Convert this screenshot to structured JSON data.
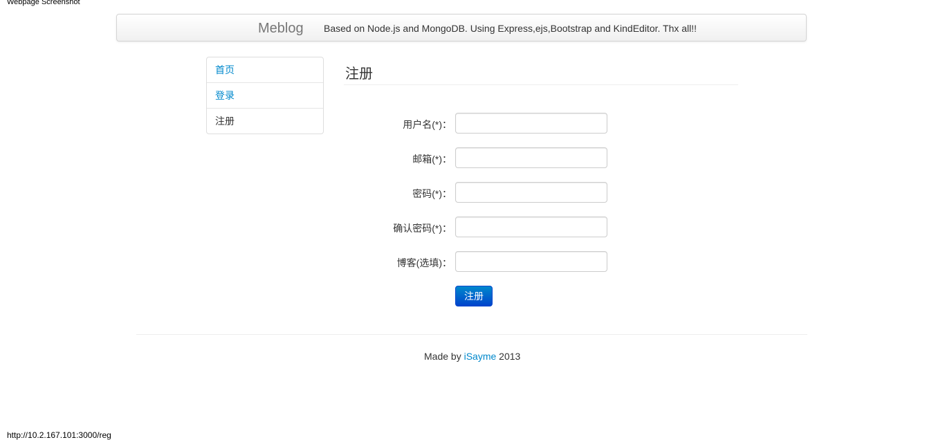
{
  "window": {
    "caption": "Webpage Screenshot",
    "status_url": "http://10.2.167.101:3000/reg"
  },
  "navbar": {
    "brand": "Meblog",
    "text": "Based on Node.js and MongoDB. Using Express,ejs,Bootstrap and KindEditor. Thx all!!"
  },
  "sidebar": {
    "items": [
      {
        "label": "首页",
        "active": false
      },
      {
        "label": "登录",
        "active": false
      },
      {
        "label": "注册",
        "active": true
      }
    ]
  },
  "main": {
    "title": "注册",
    "form": {
      "fields": [
        {
          "label": "用户名(*)：",
          "value": "",
          "placeholder": ""
        },
        {
          "label": "邮箱(*)：",
          "value": "",
          "placeholder": ""
        },
        {
          "label": "密码(*)：",
          "value": "",
          "placeholder": ""
        },
        {
          "label": "确认密码(*)：",
          "value": "",
          "placeholder": ""
        },
        {
          "label": "博客(选填)：",
          "value": "",
          "placeholder": ""
        }
      ],
      "submit_label": "注册"
    }
  },
  "footer": {
    "prefix": "Made by",
    "author_link": "iSayme",
    "year": "2013"
  },
  "colors": {
    "link": "#0088cc",
    "button_top": "#0088cc",
    "button_bottom": "#0044cc",
    "text": "#333333"
  }
}
